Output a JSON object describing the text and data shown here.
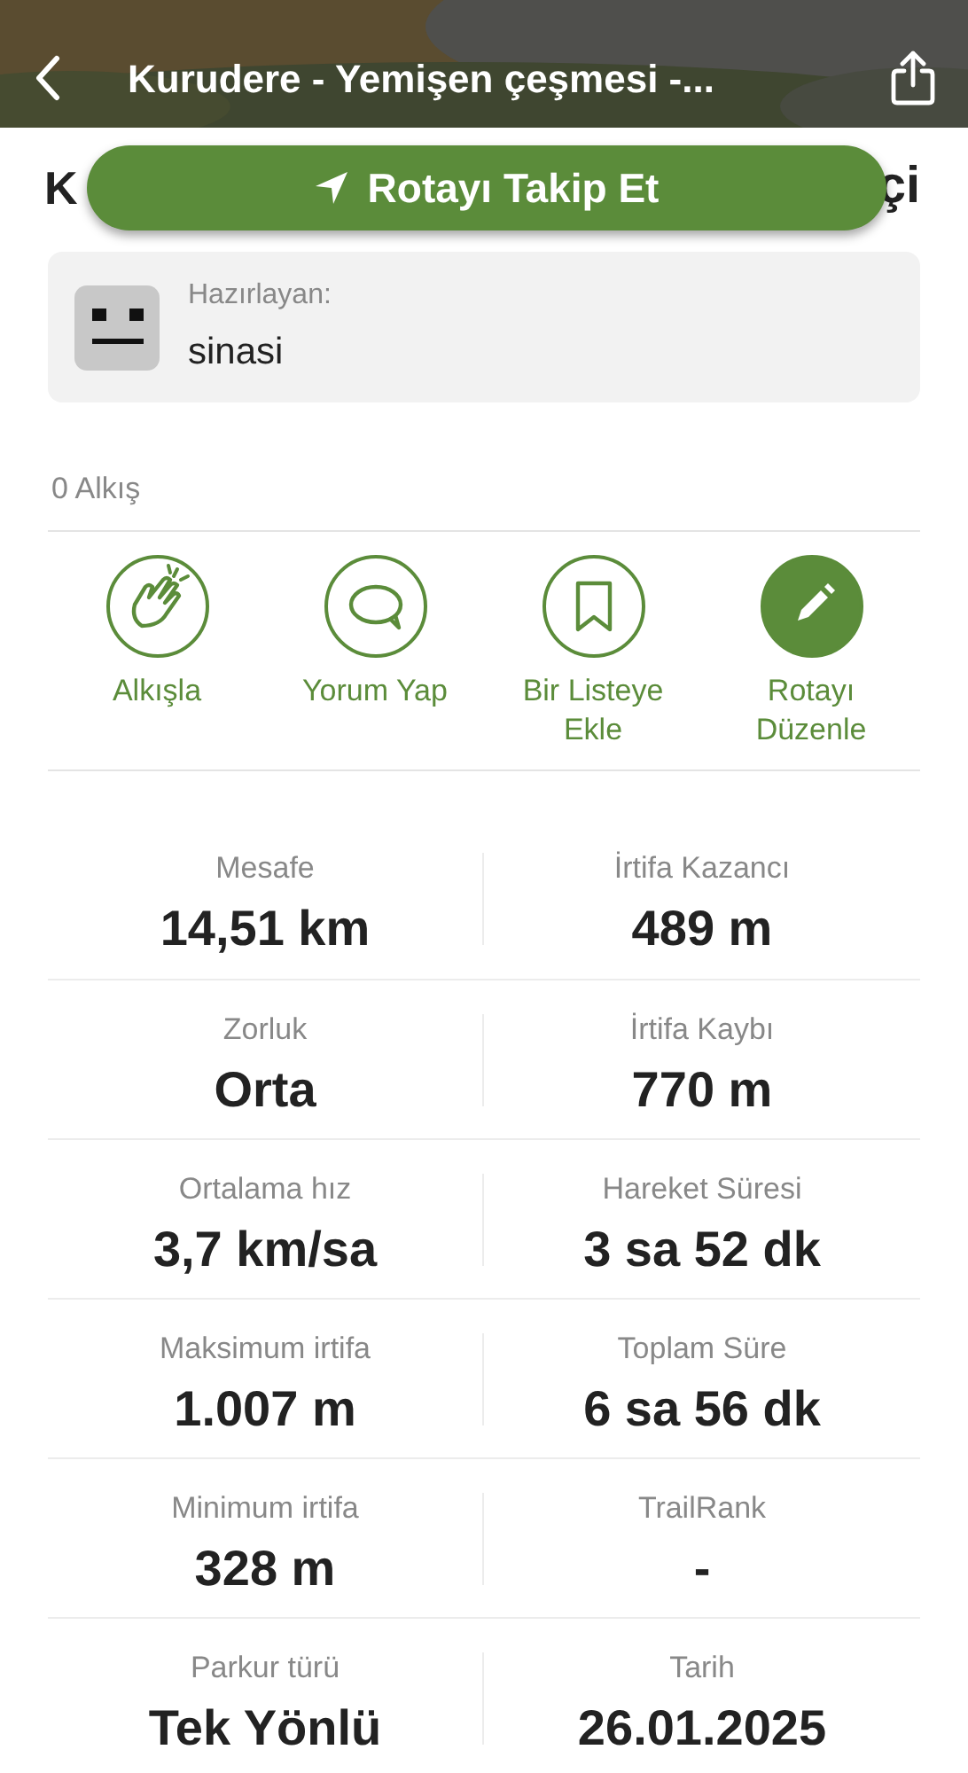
{
  "header": {
    "title": "Kurudere - Yemişen çeşmesi -..."
  },
  "hidden_title": {
    "left": "K",
    "right": "çi"
  },
  "follow_button": {
    "label": "Rotayı Takip Et"
  },
  "author": {
    "label": "Hazırlayan:",
    "name": "sinasi"
  },
  "applause_count": "0 Alkış",
  "actions": [
    {
      "kind": "clap",
      "label": "Alkışla",
      "filled": false
    },
    {
      "kind": "comment",
      "label": "Yorum Yap",
      "filled": false
    },
    {
      "kind": "bookmark",
      "label": "Bir Listeye Ekle",
      "filled": false
    },
    {
      "kind": "edit",
      "label": "Rotayı Düzenle",
      "filled": true
    }
  ],
  "stats": [
    [
      {
        "label": "Mesafe",
        "value": "14,51 km"
      },
      {
        "label": "İrtifa Kazancı",
        "value": "489 m"
      }
    ],
    [
      {
        "label": "Zorluk",
        "value": "Orta"
      },
      {
        "label": "İrtifa Kaybı",
        "value": "770 m"
      }
    ],
    [
      {
        "label": "Ortalama hız",
        "value": "3,7 km/sa"
      },
      {
        "label": "Hareket Süresi",
        "value": "3 sa 52 dk"
      }
    ],
    [
      {
        "label": "Maksimum irtifa",
        "value": "1.007 m"
      },
      {
        "label": "Toplam Süre",
        "value": "6 sa 56 dk"
      }
    ],
    [
      {
        "label": "Minimum irtifa",
        "value": "328 m"
      },
      {
        "label": "TrailRank",
        "value": "-"
      }
    ],
    [
      {
        "label": "Parkur türü",
        "value": "Tek Yönlü"
      },
      {
        "label": "Tarih",
        "value": "26.01.2025"
      }
    ]
  ]
}
